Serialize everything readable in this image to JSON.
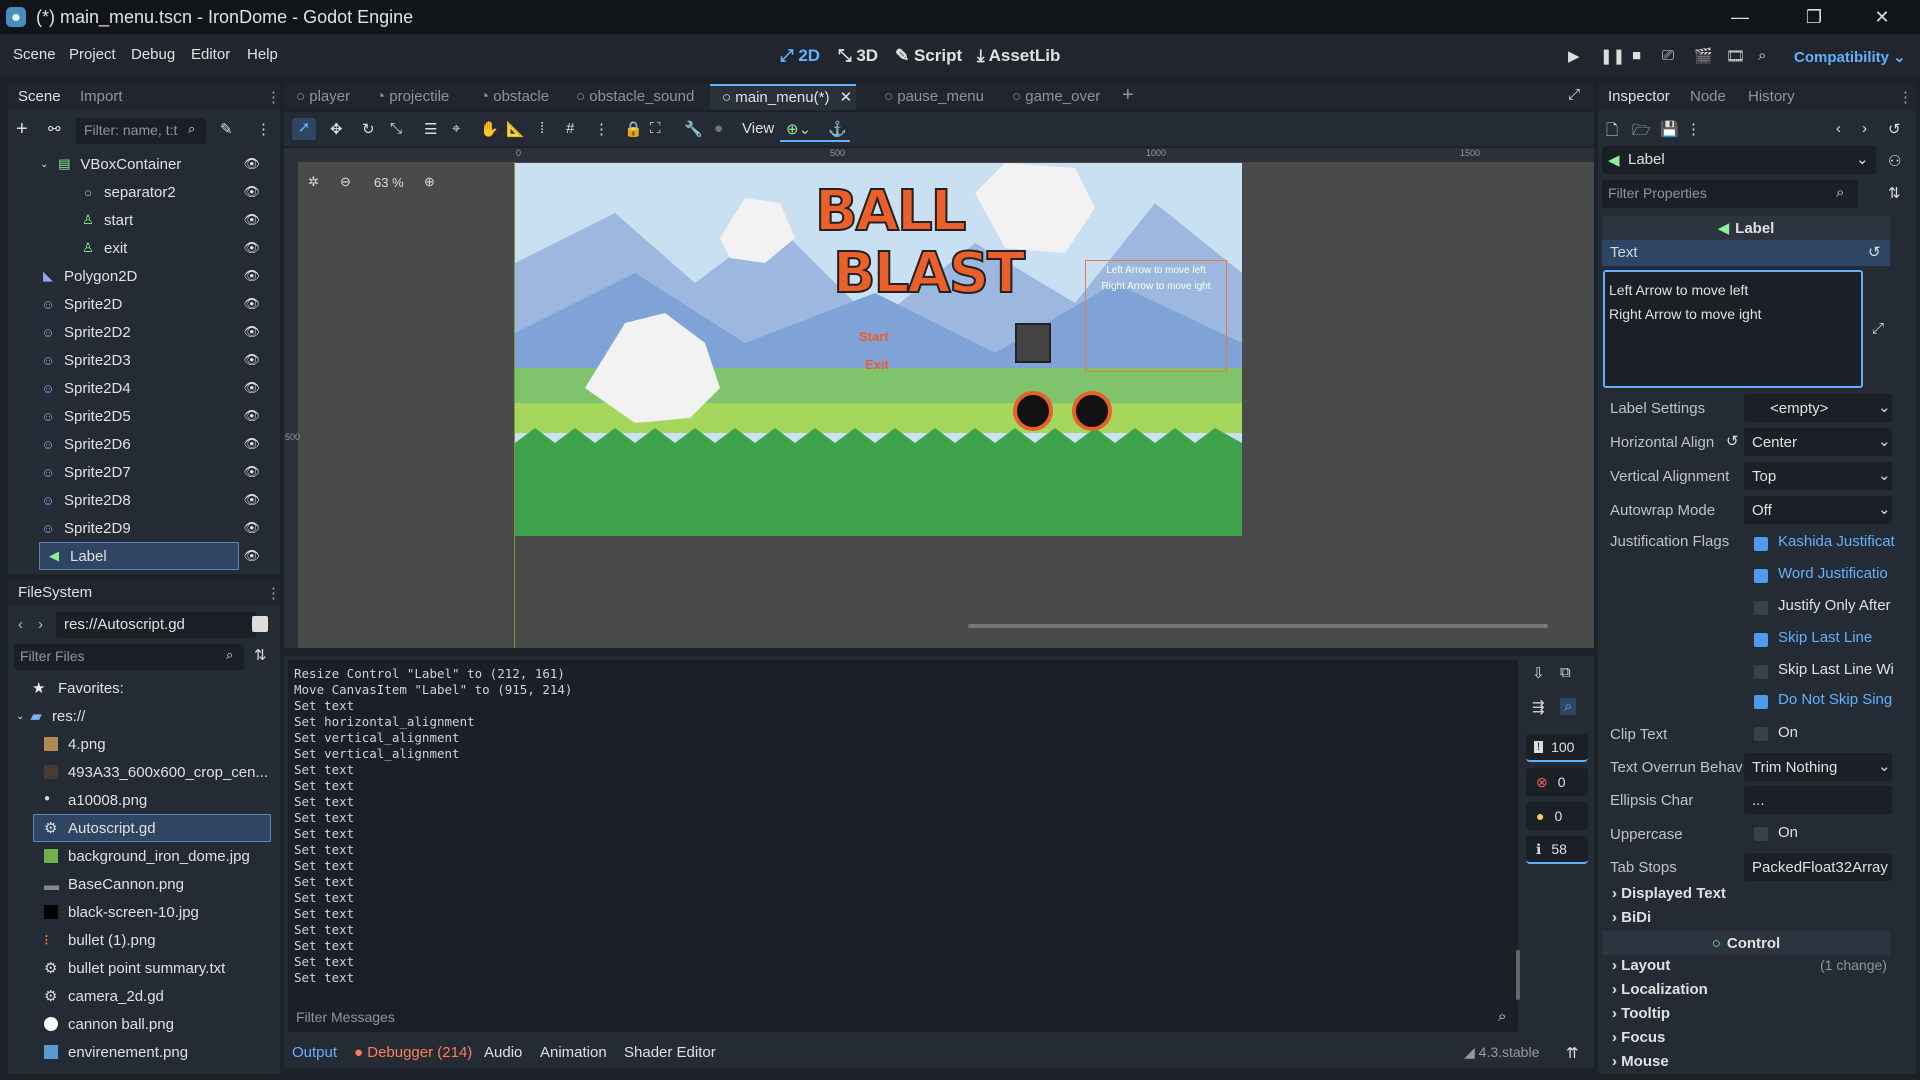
{
  "window": {
    "title": "(*) main_menu.tscn - IronDome - Godot Engine",
    "controls": [
      "minimize-icon",
      "maximize-icon",
      "close-icon"
    ]
  },
  "menubar": {
    "items": [
      "Scene",
      "Project",
      "Debug",
      "Editor",
      "Help"
    ],
    "modes": [
      "2D",
      "3D",
      "Script",
      "AssetLib"
    ],
    "renderer": "Compatibility"
  },
  "scene_dock": {
    "tabs": [
      "Scene",
      "Import"
    ],
    "filter_placeholder": "Filter: name, t:t",
    "nodes": [
      "VBoxContainer",
      "separator2",
      "start",
      "exit",
      "Polygon2D",
      "Sprite2D",
      "Sprite2D2",
      "Sprite2D3",
      "Sprite2D4",
      "Sprite2D5",
      "Sprite2D6",
      "Sprite2D7",
      "Sprite2D8",
      "Sprite2D9",
      "Label"
    ]
  },
  "filesystem": {
    "tab": "FileSystem",
    "path": "res://Autoscript.gd",
    "filter_placeholder": "Filter Files",
    "favorites": "Favorites:",
    "root": "res://",
    "files": [
      "4.png",
      "493A33_600x600_crop_cen...",
      "a10008.png",
      "Autoscript.gd",
      "background_iron_dome.jpg",
      "BaseCannon.png",
      "black-screen-10.jpg",
      "bullet (1).png",
      "bullet point summary.txt",
      "camera_2d.gd",
      "cannon ball.png",
      "envirenement.png"
    ]
  },
  "scene_tabs": [
    "player",
    "projectile",
    "obstacle",
    "obstacle_sound",
    "main_menu(*)",
    "pause_menu",
    "game_over"
  ],
  "viewport": {
    "zoom": "63 %",
    "view_label": "View",
    "ruler": [
      "0",
      "500",
      "1000",
      "1500"
    ],
    "ruler_v": "500",
    "game": {
      "title1": "BALL",
      "title2": "BLAST",
      "start": "Start",
      "exit": "Exit",
      "label_line1": "Left Arrow to move left",
      "label_line2": "Right Arrow to move ight"
    }
  },
  "output": {
    "lines": [
      "Resize Control \"Label\" to (212, 161)",
      "Move CanvasItem \"Label\" to (915, 214)",
      "Set text",
      "Set horizontal_alignment",
      "Set vertical_alignment",
      "Set vertical_alignment",
      "Set text",
      "Set text",
      "Set text",
      "Set text",
      "Set text",
      "Set text",
      "Set text",
      "Set text",
      "Set text",
      "Set text",
      "Set text",
      "Set text",
      "Set text",
      "Set text"
    ],
    "filter_placeholder": "Filter Messages",
    "counts": {
      "messages": "100",
      "errors": "0",
      "warnings": "0",
      "info": "58"
    },
    "bottom_tabs": [
      "Output",
      "Debugger (214)",
      "Audio",
      "Animation",
      "Shader Editor"
    ],
    "version": "4.3.stable"
  },
  "inspector": {
    "tabs": [
      "Inspector",
      "Node",
      "History"
    ],
    "node": "Label",
    "filter_placeholder": "Filter Properties",
    "class_header": "Label",
    "text_label": "Text",
    "text_value_line1": "Left Arrow to move left",
    "text_value_line2": "Right Arrow to move ight",
    "props": [
      {
        "k": "Label Settings",
        "v": "<empty>"
      },
      {
        "k": "Horizontal Align",
        "v": "Center"
      },
      {
        "k": "Vertical Alignment",
        "v": "Top"
      },
      {
        "k": "Autowrap Mode",
        "v": "Off"
      }
    ],
    "justification_label": "Justification Flags",
    "flags": [
      {
        "t": "Kashida Justificat",
        "on": true
      },
      {
        "t": "Word Justificatio",
        "on": true
      },
      {
        "t": "Justify Only After",
        "on": false
      },
      {
        "t": "Skip Last Line",
        "on": true
      },
      {
        "t": "Skip Last Line Wi",
        "on": false
      },
      {
        "t": "Do Not Skip Sing",
        "on": true
      }
    ],
    "clip_text": {
      "k": "Clip Text",
      "v": "On"
    },
    "overrun": {
      "k": "Text Overrun Behav",
      "v": "Trim Nothing"
    },
    "ellipsis": {
      "k": "Ellipsis Char",
      "v": "..."
    },
    "uppercase": {
      "k": "Uppercase",
      "v": "On"
    },
    "tab_stops": {
      "k": "Tab Stops",
      "v": "PackedFloat32Array"
    },
    "sections": [
      "Displayed Text",
      "BiDi"
    ],
    "control_header": "Control",
    "control_sections": [
      "Layout",
      "Localization",
      "Tooltip",
      "Focus",
      "Mouse"
    ],
    "layout_note": "(1 change)"
  },
  "colors": {
    "accent": "#5fb2ff",
    "bg": "#1d2229",
    "panel": "#252b34"
  }
}
